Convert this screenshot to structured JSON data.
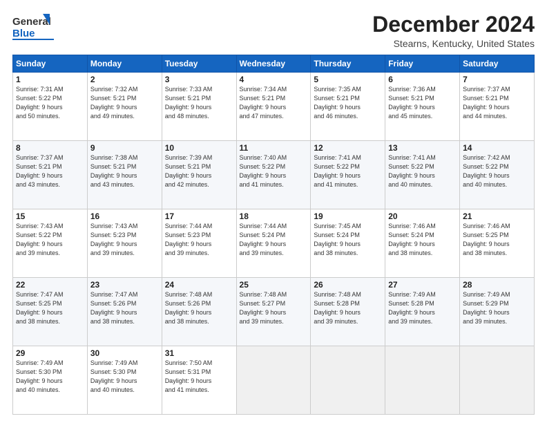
{
  "header": {
    "logo_general": "General",
    "logo_blue": "Blue",
    "month_title": "December 2024",
    "location": "Stearns, Kentucky, United States"
  },
  "days_of_week": [
    "Sunday",
    "Monday",
    "Tuesday",
    "Wednesday",
    "Thursday",
    "Friday",
    "Saturday"
  ],
  "weeks": [
    [
      {
        "day": "1",
        "info": "Sunrise: 7:31 AM\nSunset: 5:22 PM\nDaylight: 9 hours\nand 50 minutes."
      },
      {
        "day": "2",
        "info": "Sunrise: 7:32 AM\nSunset: 5:21 PM\nDaylight: 9 hours\nand 49 minutes."
      },
      {
        "day": "3",
        "info": "Sunrise: 7:33 AM\nSunset: 5:21 PM\nDaylight: 9 hours\nand 48 minutes."
      },
      {
        "day": "4",
        "info": "Sunrise: 7:34 AM\nSunset: 5:21 PM\nDaylight: 9 hours\nand 47 minutes."
      },
      {
        "day": "5",
        "info": "Sunrise: 7:35 AM\nSunset: 5:21 PM\nDaylight: 9 hours\nand 46 minutes."
      },
      {
        "day": "6",
        "info": "Sunrise: 7:36 AM\nSunset: 5:21 PM\nDaylight: 9 hours\nand 45 minutes."
      },
      {
        "day": "7",
        "info": "Sunrise: 7:37 AM\nSunset: 5:21 PM\nDaylight: 9 hours\nand 44 minutes."
      }
    ],
    [
      {
        "day": "8",
        "info": "Sunrise: 7:37 AM\nSunset: 5:21 PM\nDaylight: 9 hours\nand 43 minutes."
      },
      {
        "day": "9",
        "info": "Sunrise: 7:38 AM\nSunset: 5:21 PM\nDaylight: 9 hours\nand 43 minutes."
      },
      {
        "day": "10",
        "info": "Sunrise: 7:39 AM\nSunset: 5:21 PM\nDaylight: 9 hours\nand 42 minutes."
      },
      {
        "day": "11",
        "info": "Sunrise: 7:40 AM\nSunset: 5:22 PM\nDaylight: 9 hours\nand 41 minutes."
      },
      {
        "day": "12",
        "info": "Sunrise: 7:41 AM\nSunset: 5:22 PM\nDaylight: 9 hours\nand 41 minutes."
      },
      {
        "day": "13",
        "info": "Sunrise: 7:41 AM\nSunset: 5:22 PM\nDaylight: 9 hours\nand 40 minutes."
      },
      {
        "day": "14",
        "info": "Sunrise: 7:42 AM\nSunset: 5:22 PM\nDaylight: 9 hours\nand 40 minutes."
      }
    ],
    [
      {
        "day": "15",
        "info": "Sunrise: 7:43 AM\nSunset: 5:22 PM\nDaylight: 9 hours\nand 39 minutes."
      },
      {
        "day": "16",
        "info": "Sunrise: 7:43 AM\nSunset: 5:23 PM\nDaylight: 9 hours\nand 39 minutes."
      },
      {
        "day": "17",
        "info": "Sunrise: 7:44 AM\nSunset: 5:23 PM\nDaylight: 9 hours\nand 39 minutes."
      },
      {
        "day": "18",
        "info": "Sunrise: 7:44 AM\nSunset: 5:24 PM\nDaylight: 9 hours\nand 39 minutes."
      },
      {
        "day": "19",
        "info": "Sunrise: 7:45 AM\nSunset: 5:24 PM\nDaylight: 9 hours\nand 38 minutes."
      },
      {
        "day": "20",
        "info": "Sunrise: 7:46 AM\nSunset: 5:24 PM\nDaylight: 9 hours\nand 38 minutes."
      },
      {
        "day": "21",
        "info": "Sunrise: 7:46 AM\nSunset: 5:25 PM\nDaylight: 9 hours\nand 38 minutes."
      }
    ],
    [
      {
        "day": "22",
        "info": "Sunrise: 7:47 AM\nSunset: 5:25 PM\nDaylight: 9 hours\nand 38 minutes."
      },
      {
        "day": "23",
        "info": "Sunrise: 7:47 AM\nSunset: 5:26 PM\nDaylight: 9 hours\nand 38 minutes."
      },
      {
        "day": "24",
        "info": "Sunrise: 7:48 AM\nSunset: 5:26 PM\nDaylight: 9 hours\nand 38 minutes."
      },
      {
        "day": "25",
        "info": "Sunrise: 7:48 AM\nSunset: 5:27 PM\nDaylight: 9 hours\nand 39 minutes."
      },
      {
        "day": "26",
        "info": "Sunrise: 7:48 AM\nSunset: 5:28 PM\nDaylight: 9 hours\nand 39 minutes."
      },
      {
        "day": "27",
        "info": "Sunrise: 7:49 AM\nSunset: 5:28 PM\nDaylight: 9 hours\nand 39 minutes."
      },
      {
        "day": "28",
        "info": "Sunrise: 7:49 AM\nSunset: 5:29 PM\nDaylight: 9 hours\nand 39 minutes."
      }
    ],
    [
      {
        "day": "29",
        "info": "Sunrise: 7:49 AM\nSunset: 5:30 PM\nDaylight: 9 hours\nand 40 minutes."
      },
      {
        "day": "30",
        "info": "Sunrise: 7:49 AM\nSunset: 5:30 PM\nDaylight: 9 hours\nand 40 minutes."
      },
      {
        "day": "31",
        "info": "Sunrise: 7:50 AM\nSunset: 5:31 PM\nDaylight: 9 hours\nand 41 minutes."
      },
      {
        "day": "",
        "info": ""
      },
      {
        "day": "",
        "info": ""
      },
      {
        "day": "",
        "info": ""
      },
      {
        "day": "",
        "info": ""
      }
    ]
  ]
}
